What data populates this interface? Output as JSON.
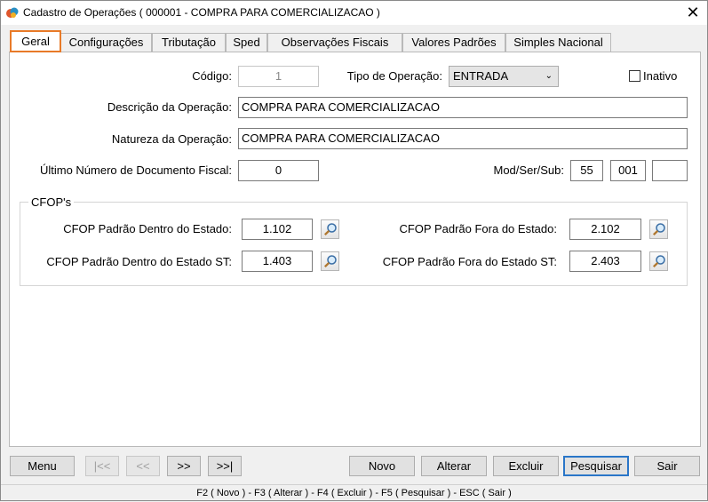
{
  "window": {
    "title": "Cadastro de Operações ( 000001 - COMPRA PARA COMERCIALIZACAO )",
    "close_glyph": "✕"
  },
  "tabs": [
    {
      "label": "Geral",
      "active": true
    },
    {
      "label": "Configurações"
    },
    {
      "label": "Tributação"
    },
    {
      "label": "Sped"
    },
    {
      "label": "Observações Fiscais"
    },
    {
      "label": "Valores Padrões"
    },
    {
      "label": "Simples Nacional"
    }
  ],
  "form": {
    "codigo_label": "Código:",
    "codigo_value": "1",
    "tipo_label": "Tipo de Operação:",
    "tipo_value": "ENTRADA",
    "inativo_label": "Inativo",
    "descricao_label": "Descrição da Operação:",
    "descricao_value": "COMPRA PARA COMERCIALIZACAO",
    "natureza_label": "Natureza da Operação:",
    "natureza_value": "COMPRA PARA COMERCIALIZACAO",
    "ultimo_label": "Último Número de Documento Fiscal:",
    "ultimo_value": "0",
    "modsersub_label": "Mod/Ser/Sub:",
    "mod_value": "55",
    "ser_value": "001",
    "sub_value": ""
  },
  "cfop": {
    "group_title": "CFOP's",
    "dentro_label": "CFOP Padrão Dentro do Estado:",
    "dentro_value": "1.102",
    "fora_label": "CFOP Padrão Fora do Estado:",
    "fora_value": "2.102",
    "dentro_st_label": "CFOP Padrão Dentro do Estado ST:",
    "dentro_st_value": "1.403",
    "fora_st_label": "CFOP Padrão Fora do Estado ST:",
    "fora_st_value": "2.403"
  },
  "buttons": {
    "menu": "Menu",
    "first": "|<<",
    "prev": "<<",
    "next": ">>",
    "last": ">>|",
    "novo": "Novo",
    "alterar": "Alterar",
    "excluir": "Excluir",
    "pesquisar": "Pesquisar",
    "sair": "Sair"
  },
  "statusbar": "F2 ( Novo )  -  F3 ( Alterar )  -  F4 ( Excluir )  -  F5 ( Pesquisar )  -  ESC ( Sair )",
  "colors": {
    "active_tab_border": "#e87a28",
    "focus_border": "#2a76c8"
  }
}
